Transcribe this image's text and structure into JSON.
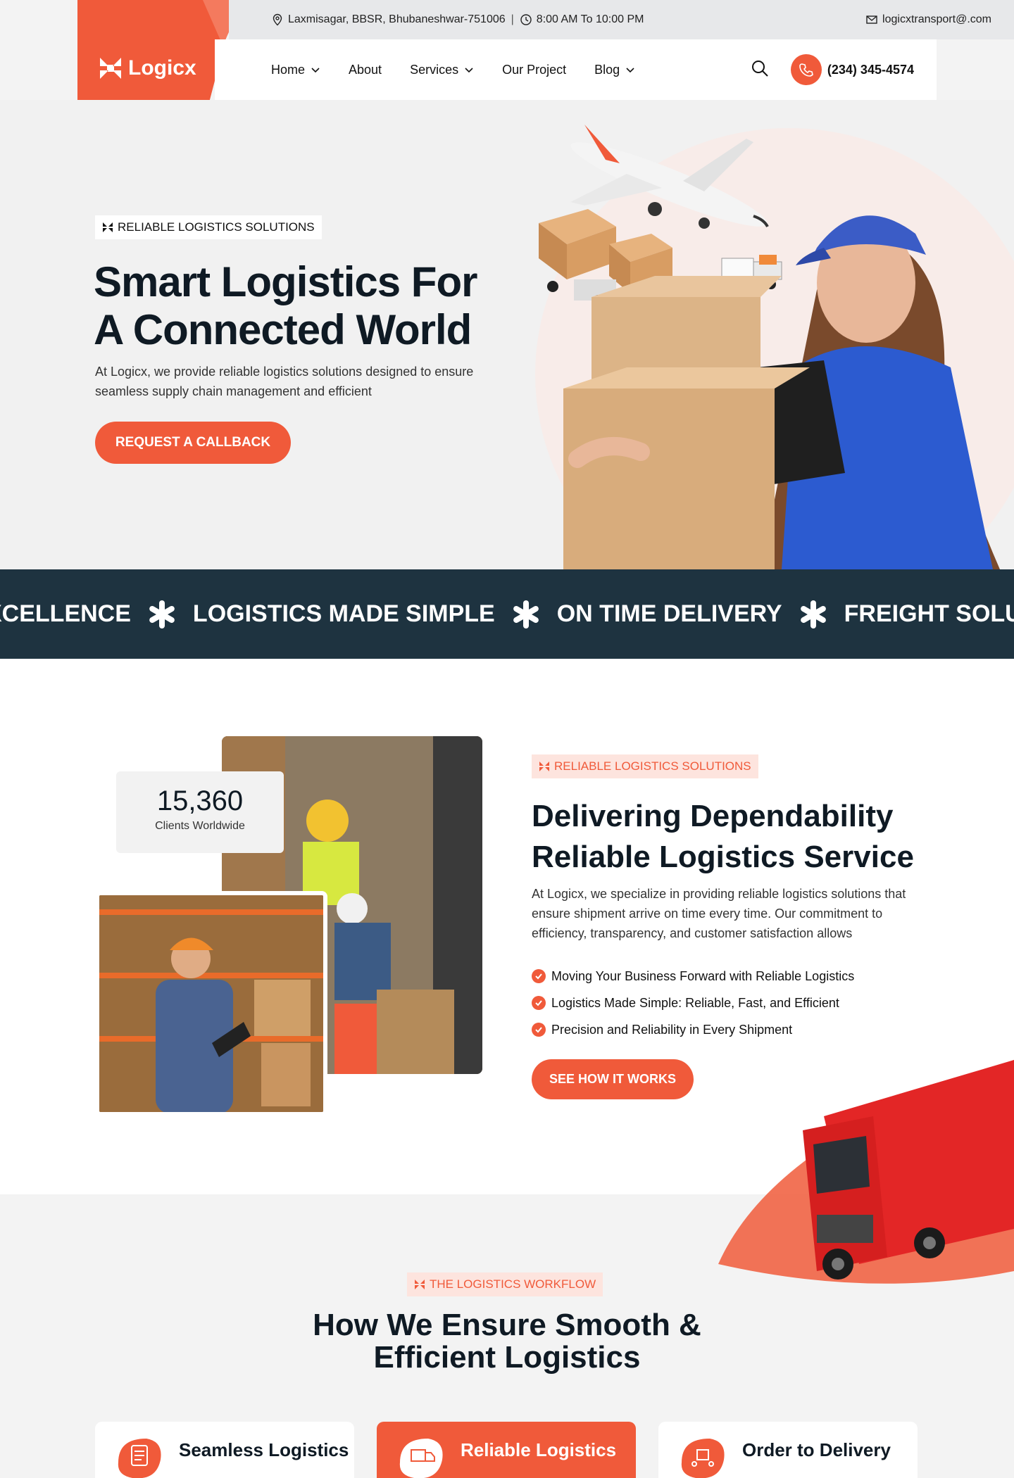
{
  "brand": {
    "name": "Logicx",
    "accent": "#f05a3a",
    "dark": "#1e3340"
  },
  "header": {
    "address": "Laxmisagar, BBSR, Bhubaneshwar-751006",
    "hours": "8:00 AM To 10:00 PM",
    "email": "logicxtransport@.com",
    "phone": "(234) 345-4574",
    "nav": [
      {
        "label": "Home",
        "dropdown": true
      },
      {
        "label": "About",
        "dropdown": false
      },
      {
        "label": "Services",
        "dropdown": true
      },
      {
        "label": "Our Project",
        "dropdown": false
      },
      {
        "label": "Blog",
        "dropdown": true
      }
    ]
  },
  "hero": {
    "badge": "RELIABLE LOGISTICS SOLUTIONS",
    "title_line1": "Smart Logistics For",
    "title_line2": "A Connected World",
    "description": "At Logicx, we provide reliable logistics solutions designed to ensure seamless supply chain management and efficient",
    "cta": "REQUEST A CALLBACK"
  },
  "ticker": {
    "items": [
      "XCELLENCE",
      "LOGISTICS MADE SIMPLE",
      "ON TIME DELIVERY",
      "FREIGHT SOLUTIONS"
    ]
  },
  "about": {
    "stat_value": "15,360",
    "stat_label": "Clients Worldwide",
    "badge": "RELIABLE LOGISTICS SOLUTIONS",
    "title_line1": "Delivering Dependability",
    "title_line2": "Reliable Logistics Service",
    "description": "At Logicx, we specialize in providing reliable logistics solutions that ensure shipment arrive on time every time. Our commitment to efficiency, transparency, and customer satisfaction allows",
    "checklist": [
      "Moving Your Business Forward with Reliable Logistics",
      "Logistics Made Simple: Reliable, Fast, and Efficient",
      "Precision and Reliability in Every Shipment"
    ],
    "cta": "SEE HOW IT WORKS"
  },
  "workflow": {
    "badge": "THE LOGISTICS WORKFLOW",
    "title_line1": "How We Ensure Smooth &",
    "title_line2": "Efficient Logistics",
    "cards": [
      {
        "title": "Seamless Logistics",
        "icon": "document-icon",
        "active": false
      },
      {
        "title": "Reliable Logistics",
        "icon": "truck-card-icon",
        "active": true
      },
      {
        "title": "Order to Delivery",
        "icon": "box-network-icon",
        "active": false
      }
    ]
  }
}
